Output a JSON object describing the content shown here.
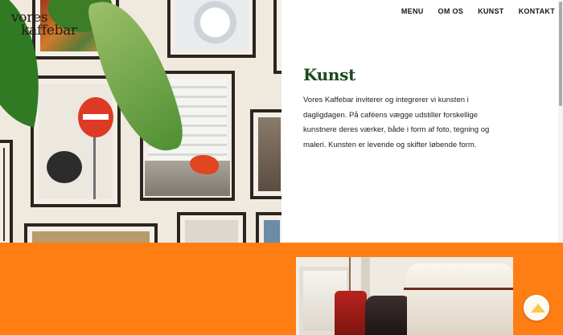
{
  "brand": {
    "logo_line1": "vores",
    "logo_line2": "kaffebar"
  },
  "nav": {
    "items": [
      {
        "label": "MENU"
      },
      {
        "label": "OM OS"
      },
      {
        "label": "KUNST"
      },
      {
        "label": "KONTAKT"
      }
    ]
  },
  "section": {
    "title": "Kunst",
    "body": "Vores Kaffebar inviterer og integrerer vi kunsten i dagligdagen. På caféens vægge udstiller forskellige kunstnere deres værker, både i form af foto, tegning og maleri. Kunsten er levende og skifter løbende form."
  },
  "colors": {
    "accent_orange": "#ff7e14",
    "title_green": "#1a4a1f",
    "scroll_button_icon": "#f7c948"
  },
  "icons": {
    "back_to_top": "chevron-up-icon"
  }
}
